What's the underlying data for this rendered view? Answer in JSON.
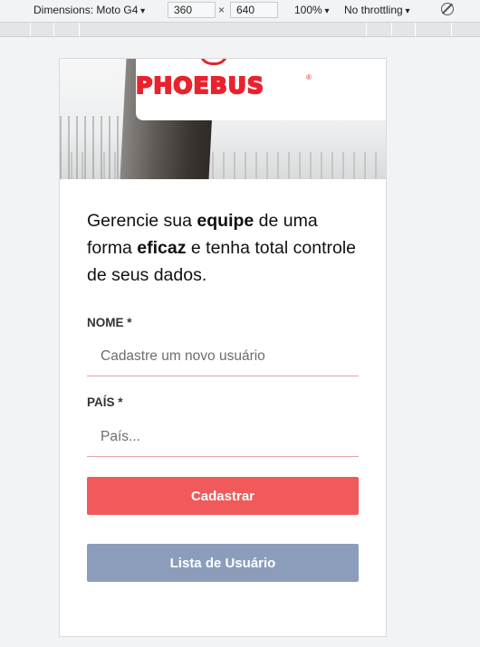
{
  "devtools": {
    "device_label": "Dimensions: Moto G4",
    "width": "360",
    "height": "640",
    "zoom": "100%",
    "throttling": "No throttling",
    "rotate_icon": "rotate-icon"
  },
  "brand": {
    "logo_text": "PHOEBUS",
    "registered_mark": "®",
    "accent_color": "#e8232e"
  },
  "intro": {
    "part1": "Gerencie sua ",
    "bold1": "equipe",
    "part2": " de uma forma ",
    "bold2": "eficaz",
    "part3": " e tenha total controle de seus dados."
  },
  "form": {
    "name_label": "NOME *",
    "name_placeholder": "Cadastre um novo usuário",
    "country_label": "PAÍS *",
    "country_placeholder": "País...",
    "submit_label": "Cadastrar",
    "list_label": "Lista de Usuário",
    "primary_color": "#f05a5b",
    "secondary_color": "#8b9dbb"
  }
}
